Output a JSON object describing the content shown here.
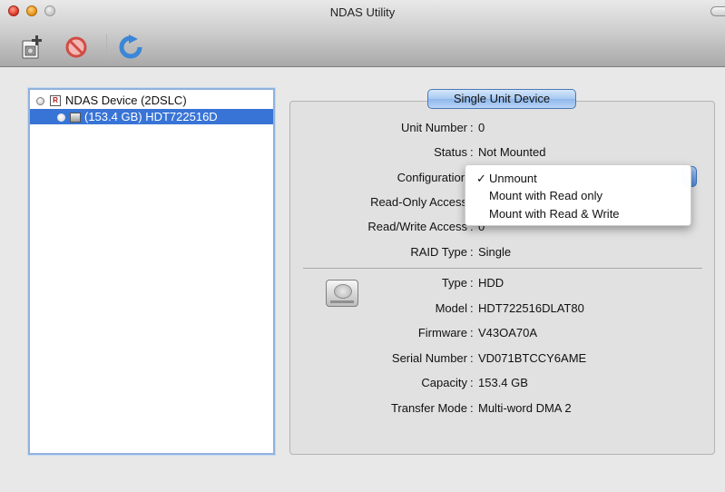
{
  "window": {
    "title": "NDAS Utility"
  },
  "toolbar": {
    "icons": [
      "add-device-icon",
      "remove-device-icon",
      "refresh-icon"
    ]
  },
  "source_list": {
    "items": [
      {
        "badge": "R",
        "label": "NDAS Device (2DSLC)"
      },
      {
        "label": "(153.4 GB) HDT722516D"
      }
    ]
  },
  "panel": {
    "tab": "Single Unit Device",
    "unit": [
      {
        "label": "Unit Number",
        "value": "0"
      },
      {
        "label": "Status",
        "value": "Not Mounted"
      },
      {
        "label": "Configuration",
        "value": ""
      },
      {
        "label": "Read-Only Access",
        "value": ""
      },
      {
        "label": "Read/Write Access",
        "value": "0"
      },
      {
        "label": "RAID Type",
        "value": "Single"
      }
    ],
    "disk": [
      {
        "label": "Type",
        "value": "HDD"
      },
      {
        "label": "Model",
        "value": "HDT722516DLAT80"
      },
      {
        "label": "Firmware",
        "value": "V43OA70A"
      },
      {
        "label": "Serial Number",
        "value": "VD071BTCCY6AME"
      },
      {
        "label": "Capacity",
        "value": "153.4 GB"
      },
      {
        "label": "Transfer Mode",
        "value": "Multi-word DMA 2"
      }
    ]
  },
  "configuration_menu": {
    "items": [
      {
        "check": "✓",
        "label": "Unmount"
      },
      {
        "check": "",
        "label": "Mount with Read only"
      },
      {
        "check": "",
        "label": "Mount with Read & Write"
      }
    ]
  },
  "colors": {
    "selection": "#3874d6",
    "accent": "#8eb7ec"
  }
}
